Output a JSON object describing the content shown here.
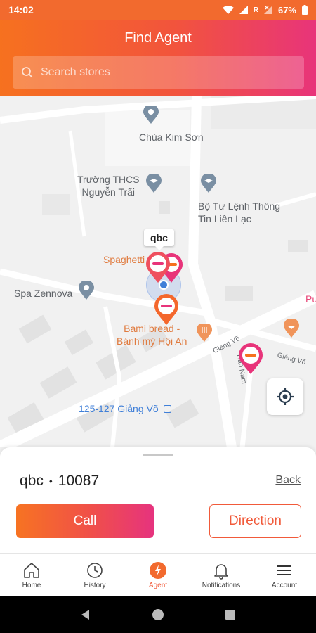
{
  "status_bar": {
    "time": "14:02",
    "battery": "67%",
    "roaming": "R"
  },
  "header": {
    "title": "Find Agent",
    "search_placeholder": "Search stores"
  },
  "map": {
    "pois": [
      {
        "name": "Chùa Kim Sơn"
      },
      {
        "name_line1": "Trường THCS",
        "name_line2": "Nguyễn Trãi"
      },
      {
        "name_line1": "Bộ Tư Lệnh Thông",
        "name_line2": "Tin Liên Lạc"
      },
      {
        "name": "Spaghetti"
      },
      {
        "name": "Spa Zennova"
      },
      {
        "name_line1": "Bami bread -",
        "name_line2": "Bánh mỳ Hội An"
      },
      {
        "name": "125-127 Giảng Võ"
      },
      {
        "name": "Pu"
      }
    ],
    "streets": [
      "Giảng Võ",
      "Hào Nam",
      "Giảng Võ"
    ],
    "selected_bubble": "qbc"
  },
  "sheet": {
    "agent_name": "qbc",
    "separator": "•",
    "agent_id": "10087",
    "back_label": "Back",
    "call_label": "Call",
    "direction_label": "Direction"
  },
  "nav": {
    "items": [
      {
        "label": "Home",
        "icon": "home-icon"
      },
      {
        "label": "History",
        "icon": "clock-icon"
      },
      {
        "label": "Agent",
        "icon": "agent-icon",
        "active": true
      },
      {
        "label": "Notifications",
        "icon": "bell-icon"
      },
      {
        "label": "Account",
        "icon": "menu-icon"
      }
    ]
  },
  "colors": {
    "accent_orange": "#f6711f",
    "accent_pink": "#e8347a",
    "direction": "#f15a3a"
  }
}
